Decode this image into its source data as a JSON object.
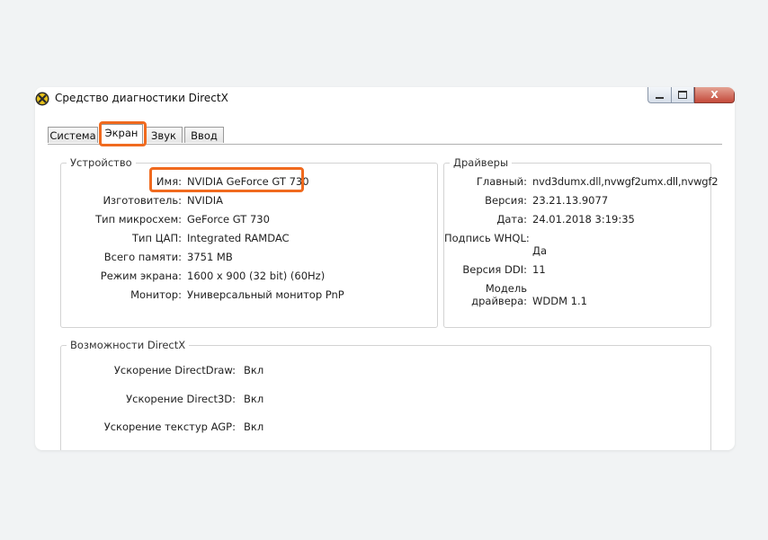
{
  "window": {
    "title": "Средство диагностики DirectX",
    "controls": {
      "close": "X"
    }
  },
  "tabs": [
    {
      "label": "Система",
      "active": false
    },
    {
      "label": "Экран",
      "active": true
    },
    {
      "label": "Звук",
      "active": false
    },
    {
      "label": "Ввод",
      "active": false
    }
  ],
  "device": {
    "title": "Устройство",
    "rows": [
      {
        "label": "Имя:",
        "value": "NVIDIA GeForce GT 730"
      },
      {
        "label": "Изготовитель:",
        "value": "NVIDIA"
      },
      {
        "label": "Тип микросхем:",
        "value": "GeForce GT 730"
      },
      {
        "label": "Тип ЦАП:",
        "value": "Integrated RAMDAC"
      },
      {
        "label": "Всего памяти:",
        "value": "3751 MB"
      },
      {
        "label": "Режим экрана:",
        "value": "1600 x 900 (32 bit) (60Hz)"
      },
      {
        "label": "Монитор:",
        "value": "Универсальный монитор PnP"
      }
    ]
  },
  "drivers": {
    "title": "Драйверы",
    "main_label": "Главный:",
    "main_value": "nvd3dumx.dll,nvwgf2umx.dll,nvwgf2",
    "version_label": "Версия:",
    "version_value": "23.21.13.9077",
    "date_label": "Дата:",
    "date_value": "24.01.2018 3:19:35",
    "whql_label": "Подпись WHQL:",
    "whql_value": "Да",
    "ddi_label": "Версия DDI:",
    "ddi_value": "11",
    "model_label_line1": "Модель",
    "model_label_line2": "драйвера:",
    "model_value": "WDDM 1.1"
  },
  "features": {
    "title": "Возможности DirectX",
    "rows": [
      {
        "label": "Ускорение DirectDraw:",
        "value": "Вкл"
      },
      {
        "label": "Ускорение Direct3D:",
        "value": "Вкл"
      },
      {
        "label": "Ускорение текстур AGP:",
        "value": "Вкл"
      }
    ]
  },
  "colors": {
    "highlight": "#f06a1e",
    "background": "#f1f3f4"
  },
  "icons": {
    "app": "directx-icon"
  }
}
